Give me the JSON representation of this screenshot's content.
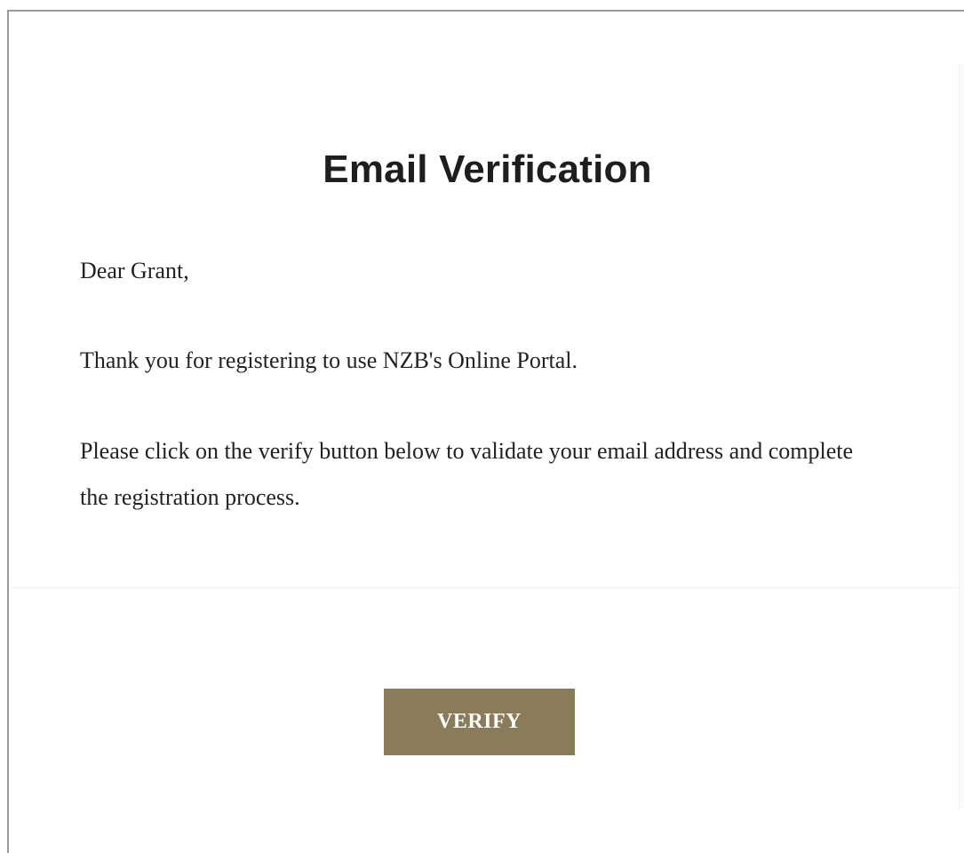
{
  "email": {
    "title": "Email Verification",
    "greeting": "Dear Grant,",
    "thanks": "Thank you for registering to use NZB's Online Portal.",
    "instructions": "Please click on the verify button below to validate your email address and complete the registration process.",
    "verify_label": "VERIFY"
  },
  "colors": {
    "button_bg": "#8a7b5b",
    "button_text": "#ffffff",
    "title_text": "#1e1e1e",
    "body_text": "#222222",
    "frame_border": "#9a9a9a"
  }
}
